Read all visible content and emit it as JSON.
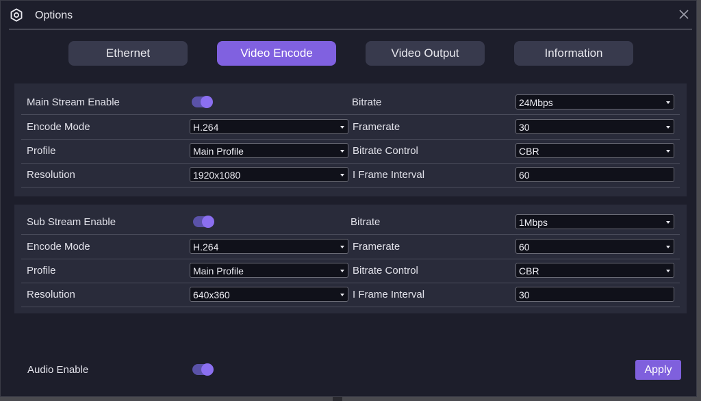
{
  "window": {
    "title": "Options"
  },
  "tabs": [
    {
      "label": "Ethernet",
      "active": false
    },
    {
      "label": "Video Encode",
      "active": true
    },
    {
      "label": "Video Output",
      "active": false
    },
    {
      "label": "Information",
      "active": false
    }
  ],
  "main_stream": {
    "enable_label": "Main Stream Enable",
    "enabled": true,
    "encode_mode_label": "Encode Mode",
    "encode_mode": "H.264",
    "profile_label": "Profile",
    "profile": "Main Profile",
    "resolution_label": "Resolution",
    "resolution": "1920x1080",
    "bitrate_label": "Bitrate",
    "bitrate": "24Mbps",
    "framerate_label": "Framerate",
    "framerate": "30",
    "bitrate_control_label": "Bitrate Control",
    "bitrate_control": "CBR",
    "iframe_interval_label": "I Frame Interval",
    "iframe_interval": "60"
  },
  "sub_stream": {
    "enable_label": "Sub Stream Enable",
    "enabled": true,
    "encode_mode_label": "Encode Mode",
    "encode_mode": "H.264",
    "profile_label": "Profile",
    "profile": "Main Profile",
    "resolution_label": "Resolution",
    "resolution": "640x360",
    "bitrate_label": "Bitrate",
    "bitrate": "1Mbps",
    "framerate_label": "Framerate",
    "framerate": "60",
    "bitrate_control_label": "Bitrate Control",
    "bitrate_control": "CBR",
    "iframe_interval_label": "I Frame Interval",
    "iframe_interval": "30"
  },
  "audio": {
    "enable_label": "Audio Enable",
    "enabled": true
  },
  "apply_label": "Apply",
  "colors": {
    "accent": "#8061e0",
    "background": "#1d1e2b",
    "panel": "#292b3a",
    "tab": "#383a4d"
  },
  "icons": {
    "title": "gear-icon",
    "close": "close-icon",
    "dropdown": "chevron-down-icon"
  }
}
